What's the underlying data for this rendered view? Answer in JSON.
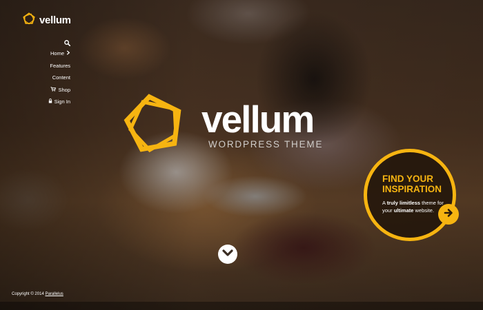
{
  "brand": {
    "name": "vellum",
    "accent": "#f6b411"
  },
  "nav": {
    "items": [
      {
        "label": "Home",
        "icon": "chevron-right-icon"
      },
      {
        "label": "Features",
        "icon": ""
      },
      {
        "label": "Content",
        "icon": ""
      },
      {
        "label": "Shop",
        "icon": "cart-icon"
      },
      {
        "label": "Sign In",
        "icon": "lock-icon"
      }
    ],
    "search_icon": "search-icon"
  },
  "hero": {
    "title": "vellum",
    "subtitle": "WORDPRESS THEME"
  },
  "promo": {
    "heading_line1": "FIND YOUR",
    "heading_line2": "INSPIRATION",
    "body_1": "A ",
    "body_2": "truly limitless",
    "body_3": " theme for",
    "body_4": "your ",
    "body_5": "ultimate",
    "body_6": " website."
  },
  "footer": {
    "text": "Copyright © 2014 ",
    "link": "Parallelus"
  }
}
